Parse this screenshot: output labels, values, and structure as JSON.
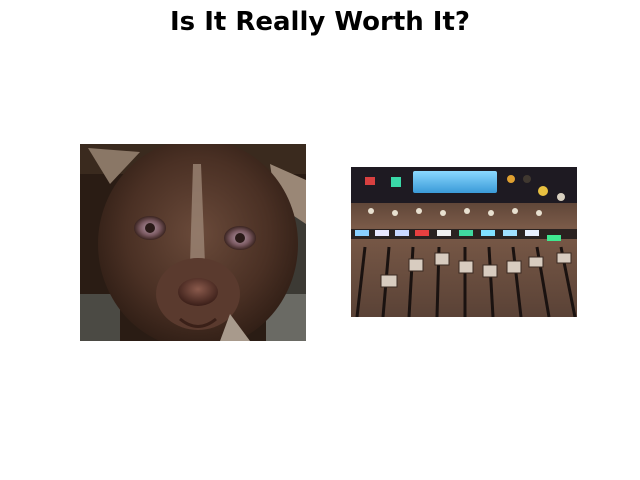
{
  "title": "Is It Really Worth It?",
  "images": [
    {
      "subject": "dog",
      "description": "Close-up photo of a brown puppy's face"
    },
    {
      "subject": "mixing-console",
      "description": "Photo of audio mixing console faders with colored lights"
    }
  ]
}
